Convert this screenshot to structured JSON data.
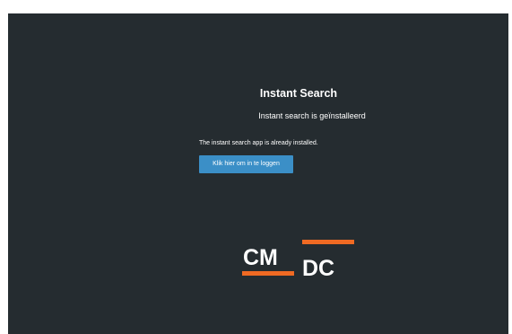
{
  "page": {
    "title": "Instant Search",
    "subtitle": "Instant search is geïnstalleerd",
    "info_text": "The instant search app is already installed.",
    "login_button_label": "Klik hier om in te loggen"
  },
  "logo": {
    "text_left": "CM",
    "text_right": "DC",
    "accent_color": "#f06a23",
    "text_color": "#ffffff"
  },
  "colors": {
    "background": "#252c30",
    "button": "#3b8fc7"
  }
}
